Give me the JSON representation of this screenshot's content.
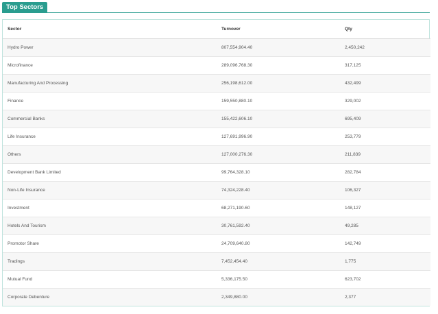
{
  "panel": {
    "title": "Top Sectors"
  },
  "table": {
    "columns": [
      "Sector",
      "Turnover",
      "Qty"
    ],
    "rows": [
      [
        "Hydro Power",
        "807,554,904.40",
        "2,450,242"
      ],
      [
        "Microfinance",
        "289,096,768.30",
        "317,125"
      ],
      [
        "Manufacturing And Processing",
        "256,198,612.00",
        "432,499"
      ],
      [
        "Finance",
        "159,550,880.10",
        "329,002"
      ],
      [
        "Commercial Banks",
        "155,422,606.10",
        "695,409"
      ],
      [
        "Life Insurance",
        "127,691,996.90",
        "253,779"
      ],
      [
        "Others",
        "127,000,276.30",
        "211,839"
      ],
      [
        "Development Bank Limited",
        "99,764,328.10",
        "282,784"
      ],
      [
        "Non-Life Insurance",
        "74,324,228.40",
        "106,327"
      ],
      [
        "Investment",
        "68,271,190.60",
        "148,127"
      ],
      [
        "Hotels And Tourism",
        "30,761,592.40",
        "49,285"
      ],
      [
        "Promotor Share",
        "24,709,640.80",
        "142,749"
      ],
      [
        "Tradings",
        "7,452,454.40",
        "1,775"
      ],
      [
        "Mutual Fund",
        "5,336,175.50",
        "623,702"
      ],
      [
        "Corporate Debenture",
        "2,349,880.00",
        "2,377"
      ]
    ]
  },
  "colors": {
    "accent": "#2a9d8f",
    "border": "#bfe3dd",
    "row_alt": "#f7f7f7"
  }
}
